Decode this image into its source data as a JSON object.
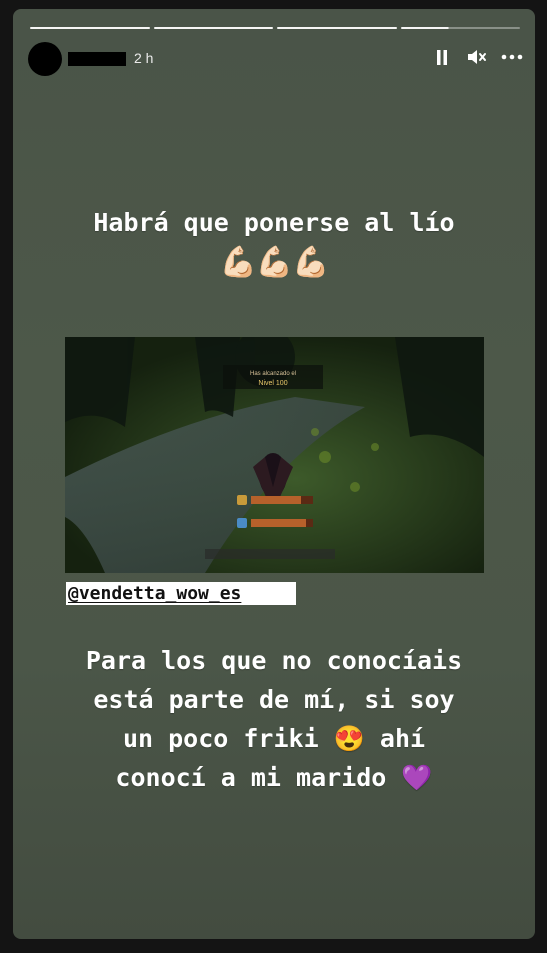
{
  "story": {
    "time": "2 h",
    "progress": {
      "segments": 4,
      "done": 3,
      "current_fraction": 0.4
    },
    "controls": {
      "pause_icon": "pause-icon",
      "mute_icon": "volume-muted-icon",
      "more_icon": "more-horizontal-icon"
    },
    "text_top": "Habrá que ponerse al lío",
    "emoji_row": "💪🏻💪🏻💪🏻",
    "game_overlay": {
      "line1": "Has alcanzado el",
      "line2": "Nivel 100"
    },
    "mention": "@vendetta_wow_es",
    "text_bottom": {
      "line1": "Para los que no conocíais",
      "line2": "está parte de mí, si soy",
      "line3_before": "un poco friki",
      "line3_emoji": "😍",
      "line3_after": "ahí",
      "line4_before": "conocí a mi marido",
      "line4_emoji": "💜"
    }
  }
}
